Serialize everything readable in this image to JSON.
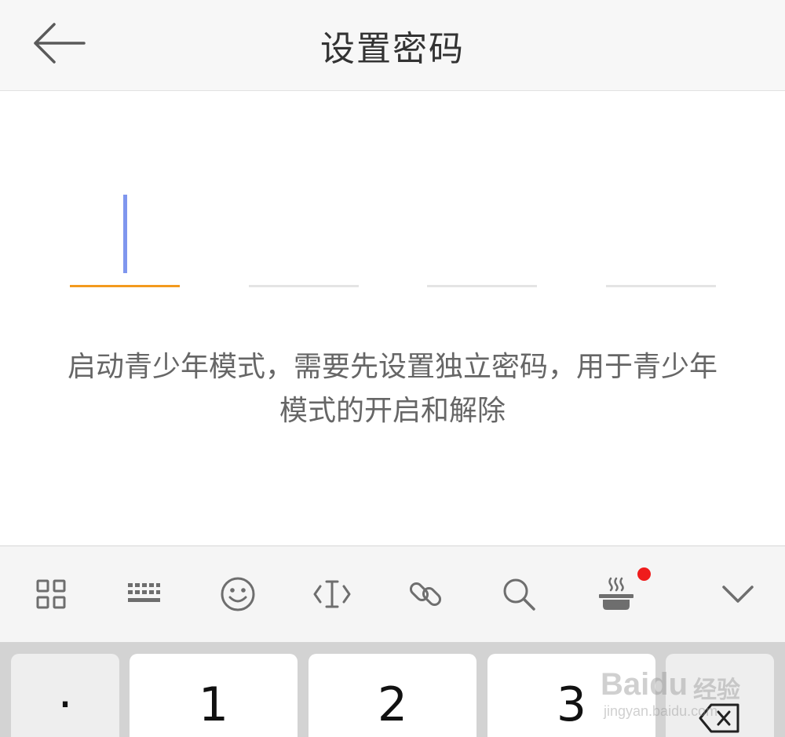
{
  "header": {
    "title": "设置密码",
    "back_icon": "arrow-left-icon"
  },
  "pin": {
    "length": 4,
    "active_index": 0,
    "colors": {
      "active_underline": "#f39a1e",
      "inactive_underline": "#e4e4e4",
      "caret": "#7f96ee"
    }
  },
  "hint": {
    "text": "启动青少年模式，需要先设置独立密码，用于青少年模式的开启和解除"
  },
  "keyboard_toolbar": {
    "tools": [
      "grid-apps-icon",
      "keyboard-icon",
      "emoji-smile-icon",
      "text-cursor-icon",
      "link-icon",
      "search-icon",
      "hot-pot-icon",
      "chevron-down-icon"
    ],
    "notification_dot_color": "#ef1c1c"
  },
  "keypad": {
    "keys": [
      {
        "label": "·"
      },
      {
        "label": "1"
      },
      {
        "label": "2"
      },
      {
        "label": "3"
      }
    ],
    "backspace_icon": "backspace-icon"
  },
  "watermark": {
    "brand": "Baidu",
    "cn": "经验",
    "url": "jingyan.baidu.com"
  }
}
